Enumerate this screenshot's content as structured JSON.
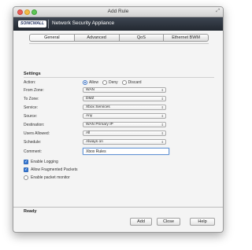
{
  "window": {
    "title": "Add Rule"
  },
  "brand": {
    "logo_text": "SONICWALL",
    "product": "Network Security Appliance"
  },
  "tabs": [
    {
      "label": "General"
    },
    {
      "label": "Advanced"
    },
    {
      "label": "QoS"
    },
    {
      "label": "Ethernet BWM"
    }
  ],
  "settings": {
    "section_title": "Settings",
    "action": {
      "label": "Action:",
      "options": [
        "Allow",
        "Deny",
        "Discard"
      ],
      "selected": "Allow"
    },
    "from_zone": {
      "label": "From Zone:",
      "value": "WAN"
    },
    "to_zone": {
      "label": "To Zone:",
      "value": "DMZ"
    },
    "service": {
      "label": "Service:",
      "value": "Xbox Services"
    },
    "source": {
      "label": "Source:",
      "value": "Any"
    },
    "destination": {
      "label": "Destination:",
      "value": "WAN Primary IP"
    },
    "users_allowed": {
      "label": "Users Allowed:",
      "value": "All"
    },
    "schedule": {
      "label": "Schedule:",
      "value": "Always on"
    },
    "comment": {
      "label": "Comment:",
      "value": "Xbox Rules"
    },
    "enable_logging": {
      "label": "Enable Logging",
      "checked": true
    },
    "allow_fragmented": {
      "label": "Allow Fragmented Packets",
      "checked": true
    },
    "enable_monitor": {
      "label": "Enable packet monitor",
      "checked": false
    }
  },
  "status": "Ready",
  "buttons": {
    "add": "Add",
    "close": "Close",
    "help": "Help"
  },
  "colors": {
    "brand_bar": "#2d343d",
    "accent": "#3a7bd5"
  }
}
